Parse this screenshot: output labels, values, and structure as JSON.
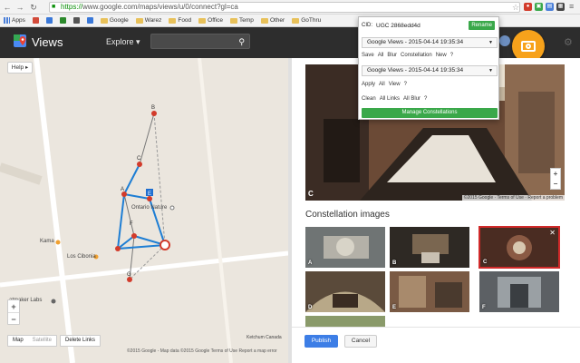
{
  "browser": {
    "url_scheme": "https://",
    "url_rest": "www.google.com/maps/views/u/0/connect?gl=ca",
    "bookmarks": [
      {
        "label": "Apps",
        "type": "apps"
      },
      {
        "label": "",
        "type": "icon",
        "color": "#d24a3a"
      },
      {
        "label": "",
        "type": "icon",
        "color": "#3a78d8"
      },
      {
        "label": "",
        "type": "icon",
        "color": "#2c8a2c"
      },
      {
        "label": "",
        "type": "icon",
        "color": "#555555"
      },
      {
        "label": "",
        "type": "icon",
        "color": "#3a78d8"
      },
      {
        "label": "Google",
        "type": "folder"
      },
      {
        "label": "Warez",
        "type": "folder"
      },
      {
        "label": "Food",
        "type": "folder"
      },
      {
        "label": "Office",
        "type": "folder"
      },
      {
        "label": "Temp",
        "type": "folder"
      },
      {
        "label": "Other",
        "type": "folder"
      },
      {
        "label": "GoThru",
        "type": "folder"
      }
    ]
  },
  "header": {
    "title": "Views",
    "explore_label": "Explore ▾",
    "search_placeholder": ""
  },
  "map": {
    "help_label": "Help ▸",
    "labels": {
      "kama": "Kama",
      "ontario": "Ontario Nature",
      "los_cibonia": "Los Cibonia",
      "labs": "atmaker Labs",
      "scale": "Ketchum Canada"
    },
    "zoom_in": "+",
    "zoom_out": "−",
    "map_type": "Map",
    "satellite_type": "Satellite",
    "delete_links": "Delete Links",
    "footer": "©2015 Google - Map data ©2015 Google    Terms of Use    Report a map error",
    "node_labels": [
      "B",
      "C",
      "A",
      "F",
      "G",
      "E"
    ]
  },
  "panel": {
    "photo_letter": "C",
    "photo_credit": "©2015 Google · Terms of Use · Report a problem",
    "zoom_in": "+",
    "zoom_out": "−",
    "section_title": "Constellation images",
    "thumbs": [
      {
        "letter": "A"
      },
      {
        "letter": "B"
      },
      {
        "letter": "C"
      },
      {
        "letter": "D"
      },
      {
        "letter": "E"
      },
      {
        "letter": "F"
      },
      {
        "letter": ""
      }
    ],
    "close_glyph": "✕",
    "publish": "Publish",
    "cancel": "Cancel"
  },
  "popup": {
    "cid_label": "CID:",
    "cid_value": "UGC 2868edd4d",
    "rename": "Rename",
    "select1": "Google Views - 2015-04-14 19:35:34",
    "save_row": [
      "Save",
      "All",
      "Blur",
      "Constellation",
      "New",
      "?"
    ],
    "select2": "Google Views - 2015-04-14 19:35:34",
    "apply_row": [
      "Apply",
      "All",
      "View",
      "?"
    ],
    "clean_row": [
      "Clean",
      "All Links",
      "All Blur",
      "?"
    ],
    "manage": "Manage Constellations"
  }
}
